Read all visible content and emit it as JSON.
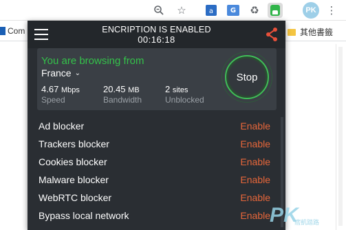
{
  "browser": {
    "bookmark_left": "Com",
    "bookmark_right": "其他書籤",
    "avatar_initials": "PK",
    "translate_label": "G",
    "icons": [
      "zoom-icon",
      "star-icon",
      "translate-icon",
      "recycle-icon",
      "vpn-extension-icon",
      "more-icon"
    ]
  },
  "vpn": {
    "header_title": "ENCRIPTION IS ENABLED",
    "timer": "00:16:18",
    "browsing_text": "You are browsing from",
    "country": "France",
    "stats": [
      {
        "value": "4.67",
        "unit": "Mbps",
        "label": "Speed"
      },
      {
        "value": "20.45",
        "unit": "MB",
        "label": "Bandwidth"
      },
      {
        "value": "2",
        "unit": "sites",
        "label": "Unblocked"
      }
    ],
    "stop_label": "Stop",
    "features": [
      {
        "name": "Ad blocker",
        "action": "Enable"
      },
      {
        "name": "Trackers blocker",
        "action": "Enable"
      },
      {
        "name": "Cookies blocker",
        "action": "Enable"
      },
      {
        "name": "Malware blocker",
        "action": "Enable"
      },
      {
        "name": "WebRTC blocker",
        "action": "Enable"
      },
      {
        "name": "Bypass local network",
        "action": "Enable"
      }
    ],
    "colors": {
      "accent_green": "#34c24a",
      "enable_orange": "#e8673a",
      "share_red": "#e8503a",
      "panel_bg": "#2a2e33"
    }
  },
  "watermark": {
    "mark": "PK",
    "sub": "痞凱踏路"
  }
}
